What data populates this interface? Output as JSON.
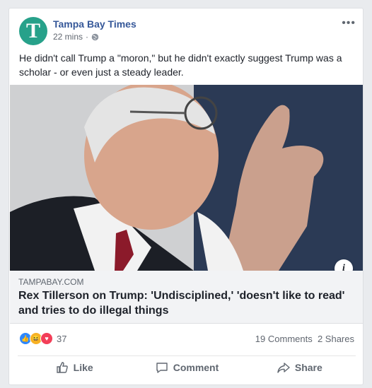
{
  "post": {
    "page_name": "Tampa Bay Times",
    "avatar_letter": "T",
    "time": "22 mins",
    "text": "He didn't call Trump a \"moron,\" but he didn't exactly suggest Trump was a scholar - or even just a steady leader."
  },
  "link": {
    "domain": "TAMPABAY.COM",
    "title": "Rex Tillerson on Trump: 'Undisciplined,' 'doesn't like to read' and tries to do illegal things",
    "info_icon": "i"
  },
  "stats": {
    "reactions_count": "37",
    "comments": "19 Comments",
    "shares": "2 Shares"
  },
  "actions": {
    "like": "Like",
    "comment": "Comment",
    "share": "Share"
  },
  "colors": {
    "page_name": "#365899",
    "avatar": "#27a18a",
    "like": "#2d88ff",
    "haha": "#f7b125",
    "love": "#f33e58"
  }
}
